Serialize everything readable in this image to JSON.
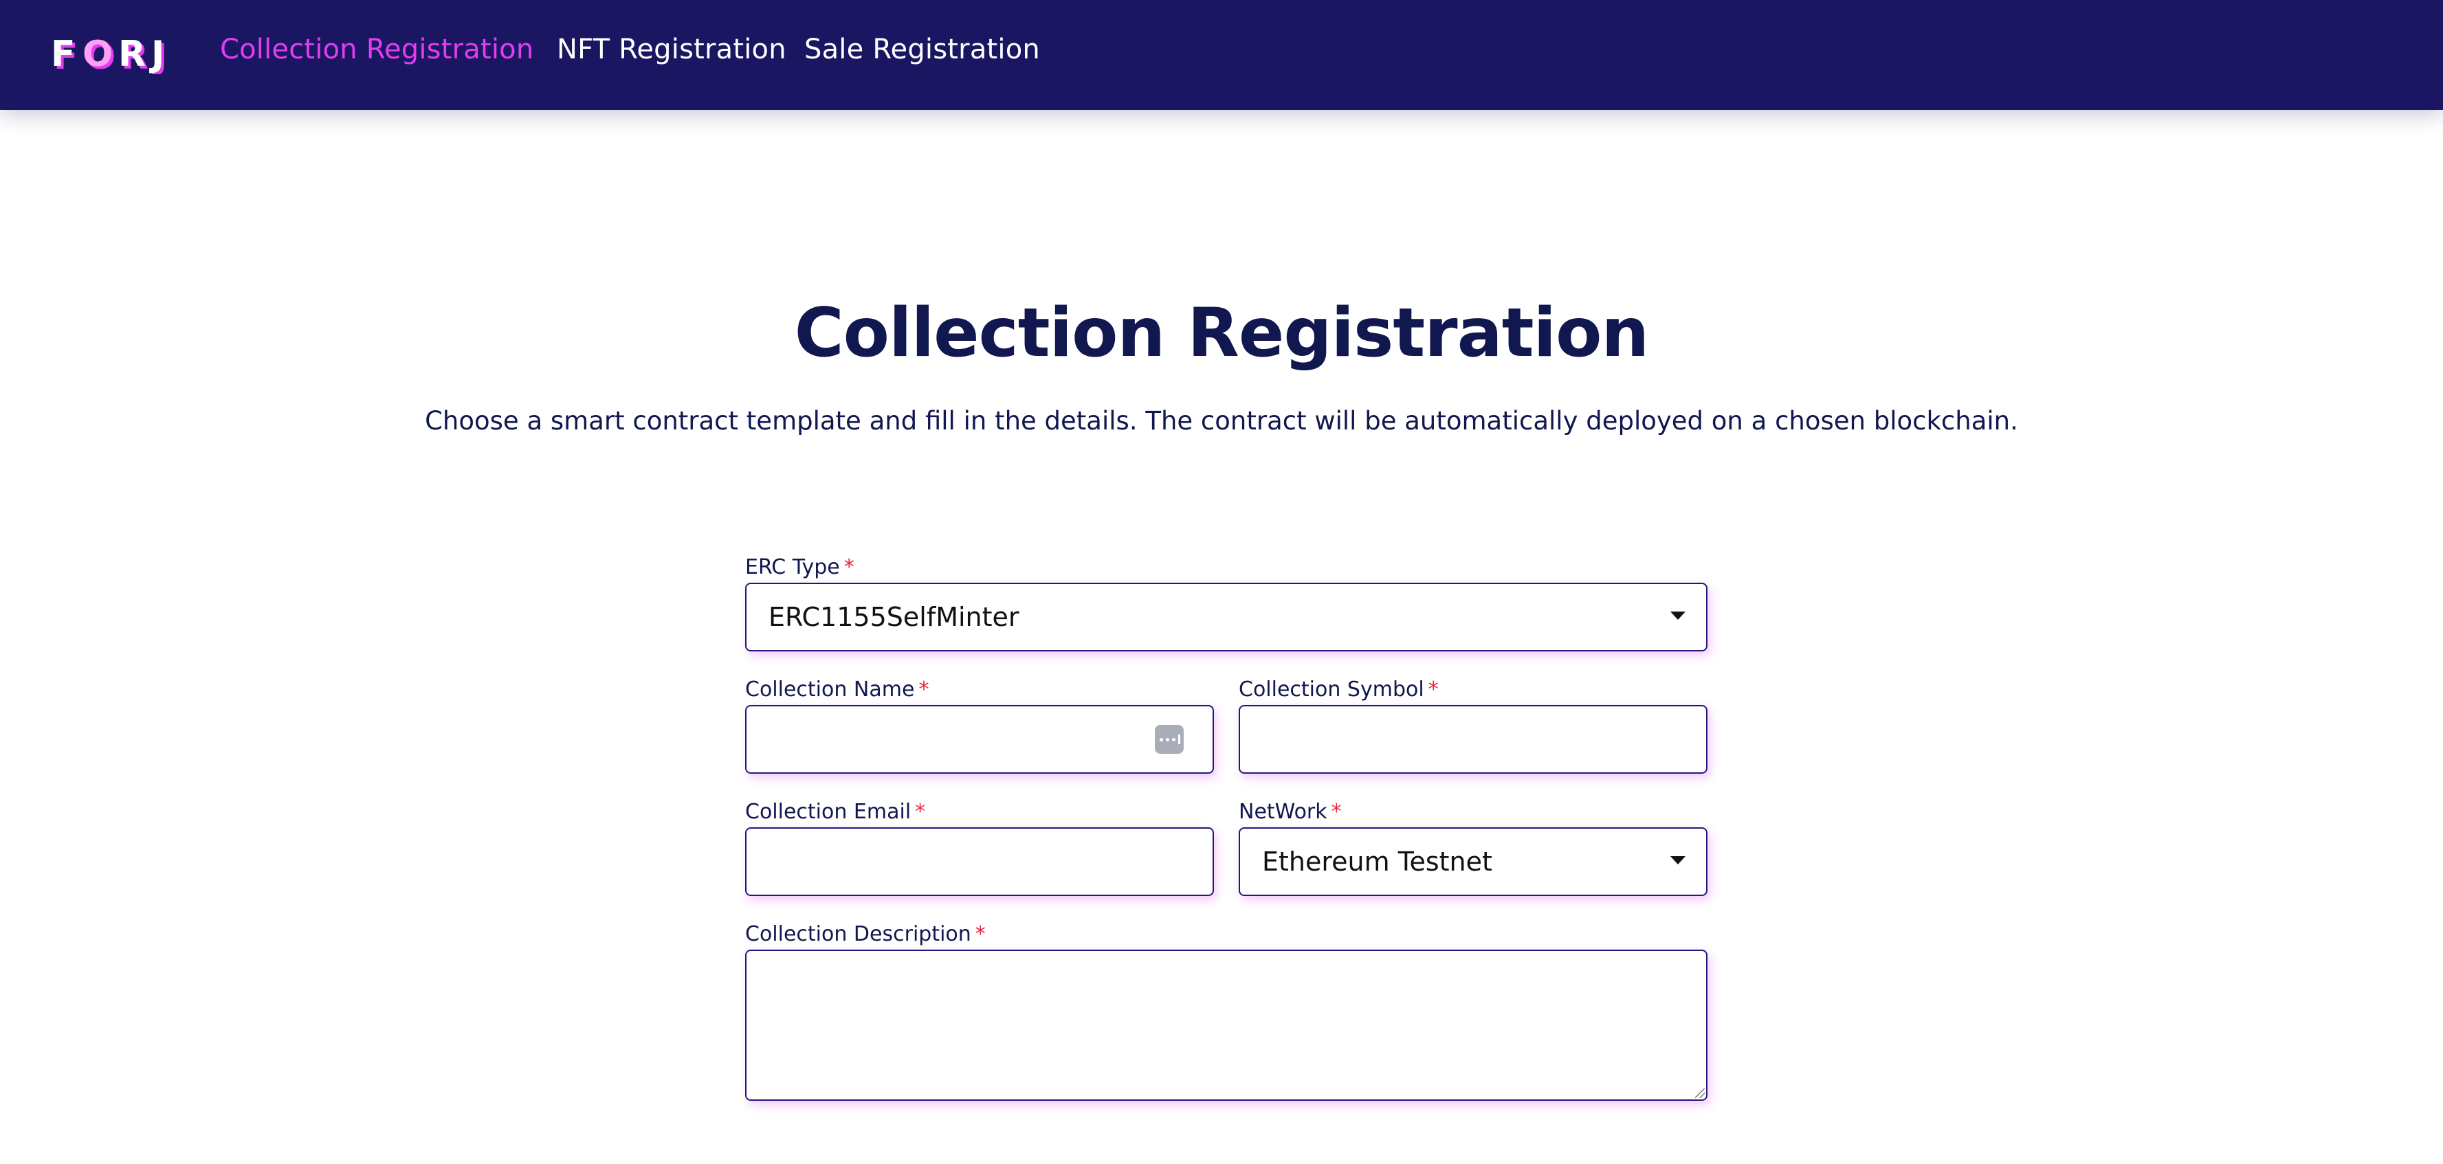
{
  "brand": {
    "logo_text": "FORJ",
    "colors": {
      "navbar_bg": "#1a1661",
      "accent": "#e23df0",
      "heading": "#11174f",
      "required": "#e5293b"
    }
  },
  "nav": {
    "items": [
      {
        "label": "Collection Registration",
        "active": true
      },
      {
        "label": "NFT Registration",
        "active": false
      },
      {
        "label": "Sale Registration",
        "active": false
      }
    ]
  },
  "page": {
    "title": "Collection Registration",
    "subtitle": "Choose a smart contract template and fill in the details. The contract will be automatically deployed on a chosen blockchain."
  },
  "form": {
    "required_mark": "*",
    "erc_type": {
      "label": "ERC Type",
      "value": "ERC1155SelfMinter",
      "icon": "chevron-down-icon"
    },
    "collection_name": {
      "label": "Collection Name",
      "value": "",
      "placeholder": "",
      "icon": "password-manager-icon"
    },
    "collection_symbol": {
      "label": "Collection Symbol",
      "value": "",
      "placeholder": ""
    },
    "collection_email": {
      "label": "Collection Email",
      "value": "",
      "placeholder": ""
    },
    "network": {
      "label": "NetWork",
      "value": "Ethereum Testnet",
      "icon": "chevron-down-icon"
    },
    "collection_description": {
      "label": "Collection Description",
      "value": "",
      "placeholder": ""
    }
  }
}
